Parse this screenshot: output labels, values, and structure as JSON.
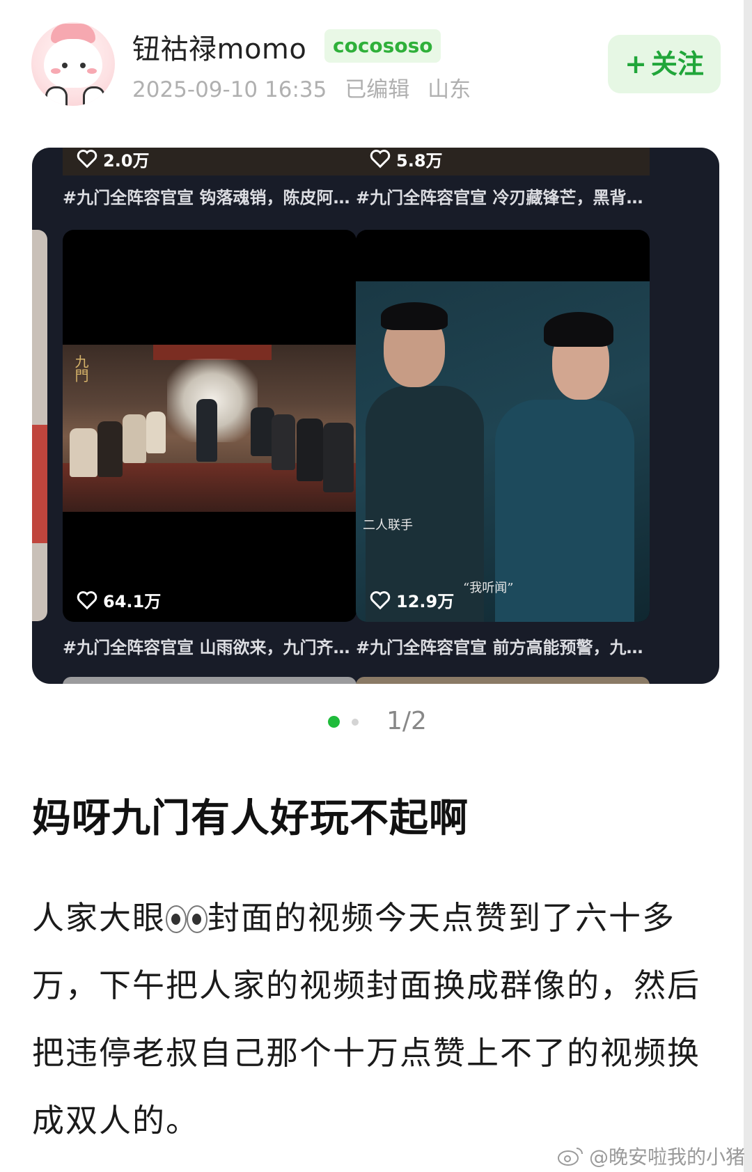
{
  "post": {
    "author": "钮祜禄momo",
    "badge": "cocososo",
    "datetime": "2025-09-10 16:35",
    "edited": "已编辑",
    "location": "山东",
    "follow_label": "关注"
  },
  "embedded": {
    "top_row": [
      {
        "likes": "2.0万",
        "caption": "#九门全阵容官宣 钩落魂销，陈皮阿…"
      },
      {
        "likes": "5.8万",
        "caption": "#九门全阵容官宣 冷刃藏锋芒，黑背…"
      }
    ],
    "main_row": [
      {
        "likes": "64.1万",
        "caption": "#九门全阵容官宣 山雨欲来，九门齐…",
        "overlay_logo": "九門"
      },
      {
        "likes": "12.9万",
        "caption": "#九门全阵容官宣 前方高能预警，九…",
        "overlay_text_1": "二人联手",
        "overlay_text_2": "“我听闻”"
      }
    ]
  },
  "pager": {
    "text": "1/2",
    "total_dots": 2,
    "active_index": 0
  },
  "title": "妈呀九门有人好玩不起啊",
  "body": {
    "part1": "人家大眼",
    "emoji": "eyes",
    "part2": "封面的视频今天点赞到了六十多万，下午把人家的视频封面换成群像的，然后把违停老叔自己那个十万点赞上不了的视频换成双人的。"
  },
  "watermark": "@晚安啦我的小猪",
  "colors": {
    "accent_green": "#21a63a",
    "badge_bg": "#e9f8e6",
    "card_bg": "#181c28"
  }
}
